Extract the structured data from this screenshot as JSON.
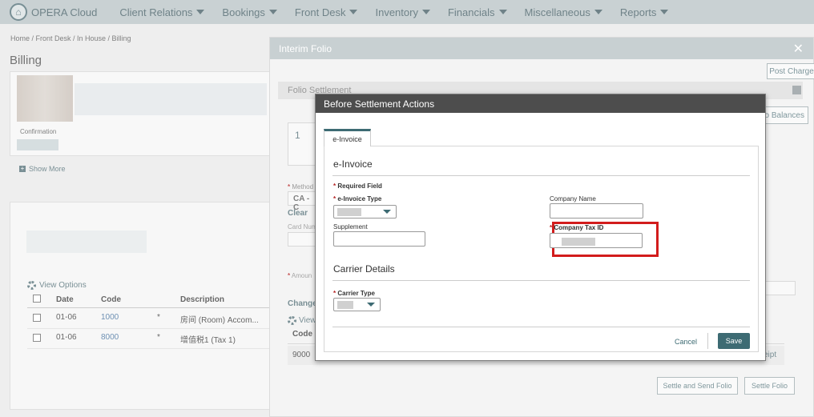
{
  "nav": {
    "brand": "OPERA Cloud",
    "items": [
      {
        "label": "Client Relations"
      },
      {
        "label": "Bookings"
      },
      {
        "label": "Front Desk"
      },
      {
        "label": "Inventory"
      },
      {
        "label": "Financials"
      },
      {
        "label": "Miscellaneous"
      },
      {
        "label": "Reports"
      }
    ]
  },
  "page": {
    "breadcrumb": "Home / Front Desk / In House / Billing",
    "title": "Billing",
    "confirmation_label": "Confirmation",
    "show_more": "Show More"
  },
  "billing_table": {
    "view_options": "View Options",
    "headers": {
      "date": "Date",
      "code": "Code",
      "description": "Description"
    },
    "rows": [
      {
        "date": "01-06",
        "code": "1000",
        "mark": "*",
        "description": "房间 (Room) Accom..."
      },
      {
        "date": "01-06",
        "code": "8000",
        "mark": "*",
        "description": "增值税1 (Tax 1)"
      }
    ]
  },
  "interim": {
    "title": "Interim Folio",
    "post_charge": "Post Charge",
    "folio_settlement": "Folio Settlement",
    "balances": "o Balances",
    "step": "1",
    "method_label": "Method",
    "method_value": "CA - C",
    "clear": "Clear",
    "card_number_label": "Card Num",
    "amount_label": "Amoun",
    "change": "Change",
    "view": "View",
    "code_header": "Code",
    "code_value": "9000",
    "receipt": "eipt",
    "settle_send": "Settle and Send Folio",
    "settle": "Settle Folio"
  },
  "modal": {
    "title": "Before Settlement Actions",
    "tab": "e-Invoice",
    "section_einvoice": "e-Invoice",
    "required_field": "Required Field",
    "einvoice_type_label": "e-Invoice Type",
    "supplement_label": "Supplement",
    "company_name_label": "Company Name",
    "company_tax_id_label": "Company Tax ID",
    "section_carrier": "Carrier Details",
    "carrier_type_label": "Carrier Type",
    "cancel": "Cancel",
    "save": "Save",
    "required_star": "*"
  }
}
